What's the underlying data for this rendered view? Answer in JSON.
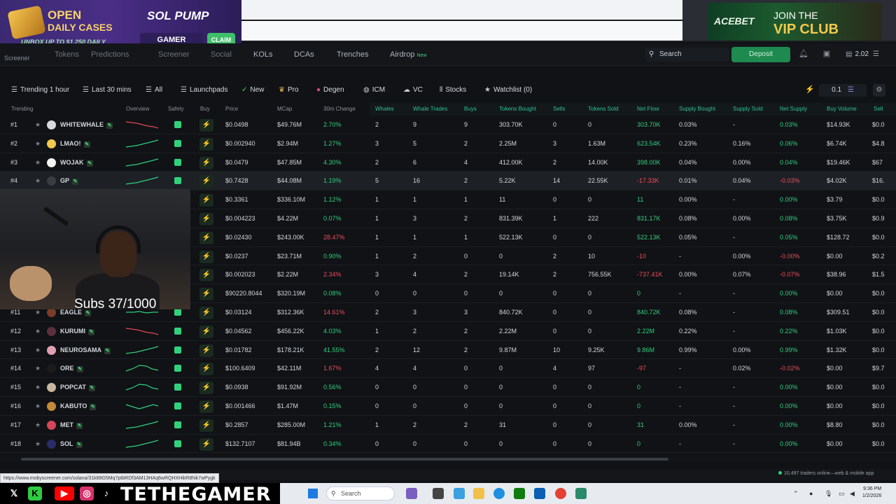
{
  "promo_left": {
    "open": "OPEN",
    "daily_cases": "DAILY CASES",
    "unbox": "UNBOX UP TO $1,250 DAILY",
    "logo": "SOL PUMP",
    "gamer": "GAMER",
    "claim": "CLAIM"
  },
  "promo_right": {
    "brand": "ACEBET",
    "join": "JOIN THE",
    "vip": "VIP CLUB"
  },
  "nav": {
    "logo": "Screener",
    "items": [
      "Tokens",
      "Predictions",
      "Screener",
      "Social",
      "KOLs",
      "DCAs",
      "Trenches",
      "Airdrop"
    ],
    "new_badge": "New",
    "search_label": "Search",
    "deposit_label": "Deposit",
    "balance": "2.02"
  },
  "filters": {
    "trending": "Trending 1 hour",
    "timeframe": "Last 30 mins",
    "all": "All",
    "launchpads": "Launchpads",
    "new": "New",
    "pro": "Pro",
    "degen": "Degen",
    "icm": "ICM",
    "vc": "VC",
    "stocks": "Stocks",
    "watchlist": "Watchlist (0)",
    "amount": "0.1"
  },
  "columns": [
    "Trending",
    "Overview",
    "Safety",
    "Buy",
    "Price",
    "MCap",
    "30m Change",
    "Whales",
    "Whale Trades",
    "Buys",
    "Tokens Bought",
    "Sells",
    "Tokens Sold",
    "Net Flow",
    "Supply Bought",
    "Supply Sold",
    "Net Supply",
    "Buy Volume",
    "Sell"
  ],
  "rows": [
    {
      "rank": "#1",
      "name": "WHITEWHALE",
      "price": "$0.0498",
      "mcap": "$49.76M",
      "change": "2.70%",
      "whales": "2",
      "whale_trades": "9",
      "buys": "9",
      "tokens_bought": "303.70K",
      "sells": "0",
      "tokens_sold": "0",
      "net_flow": "303.70K",
      "supply_bought": "0.03%",
      "supply_sold": "-",
      "net_supply": "0.03%",
      "buy_volume": "$14.93K",
      "sell": "$0.0",
      "avatar_color": "#d7d9dc",
      "change_sign": "pos",
      "flow_sign": "pos",
      "supply_sign": "pos",
      "spark": "down"
    },
    {
      "rank": "#2",
      "name": "LMAO!",
      "price": "$0.002940",
      "mcap": "$2.94M",
      "change": "1.27%",
      "whales": "3",
      "whale_trades": "5",
      "buys": "2",
      "tokens_bought": "2.25M",
      "sells": "3",
      "tokens_sold": "1.63M",
      "net_flow": "623.54K",
      "supply_bought": "0.23%",
      "supply_sold": "0.16%",
      "net_supply": "0.06%",
      "buy_volume": "$6.74K",
      "sell": "$4.8",
      "avatar_color": "#f2c94c",
      "change_sign": "pos",
      "flow_sign": "pos",
      "supply_sign": "pos",
      "spark": "up"
    },
    {
      "rank": "#3",
      "name": "WOJAK",
      "price": "$0.0479",
      "mcap": "$47.85M",
      "change": "4.30%",
      "whales": "2",
      "whale_trades": "6",
      "buys": "4",
      "tokens_bought": "412.00K",
      "sells": "2",
      "tokens_sold": "14.00K",
      "net_flow": "398.00K",
      "supply_bought": "0.04%",
      "supply_sold": "0.00%",
      "net_supply": "0.04%",
      "buy_volume": "$19.46K",
      "sell": "$67",
      "avatar_color": "#f4f4f4",
      "change_sign": "pos",
      "flow_sign": "pos",
      "supply_sign": "pos",
      "spark": "up"
    },
    {
      "rank": "#4",
      "name": "GP",
      "price": "$0.7428",
      "mcap": "$44.08M",
      "change": "1.19%",
      "whales": "5",
      "whale_trades": "16",
      "buys": "2",
      "tokens_bought": "5.22K",
      "sells": "14",
      "tokens_sold": "22.55K",
      "net_flow": "-17.33K",
      "supply_bought": "0.01%",
      "supply_sold": "0.04%",
      "net_supply": "-0.03%",
      "buy_volume": "$4.02K",
      "sell": "$16.",
      "avatar_color": "#3a3d42",
      "change_sign": "pos",
      "flow_sign": "neg",
      "supply_sign": "neg",
      "spark": "up"
    },
    {
      "rank": "",
      "name": "",
      "price": "$0.3361",
      "mcap": "$336.10M",
      "change": "1.12%",
      "whales": "1",
      "whale_trades": "1",
      "buys": "1",
      "tokens_bought": "11",
      "sells": "0",
      "tokens_sold": "0",
      "net_flow": "11",
      "supply_bought": "0.00%",
      "supply_sold": "-",
      "net_supply": "0.00%",
      "buy_volume": "$3.79",
      "sell": "$0.0",
      "avatar_color": "",
      "change_sign": "pos",
      "flow_sign": "pos",
      "supply_sign": "pos",
      "spark": ""
    },
    {
      "rank": "",
      "name": "",
      "price": "$0.004223",
      "mcap": "$4.22M",
      "change": "0.07%",
      "whales": "1",
      "whale_trades": "3",
      "buys": "2",
      "tokens_bought": "831.39K",
      "sells": "1",
      "tokens_sold": "222",
      "net_flow": "831.17K",
      "supply_bought": "0.08%",
      "supply_sold": "0.00%",
      "net_supply": "0.08%",
      "buy_volume": "$3.75K",
      "sell": "$0.9",
      "avatar_color": "",
      "change_sign": "pos",
      "flow_sign": "pos",
      "supply_sign": "pos",
      "spark": ""
    },
    {
      "rank": "",
      "name": "",
      "price": "$0.02430",
      "mcap": "$243.00K",
      "change": "28.47%",
      "whales": "1",
      "whale_trades": "1",
      "buys": "1",
      "tokens_bought": "522.13K",
      "sells": "0",
      "tokens_sold": "0",
      "net_flow": "522.13K",
      "supply_bought": "0.05%",
      "supply_sold": "-",
      "net_supply": "0.05%",
      "buy_volume": "$128.72",
      "sell": "$0.0",
      "avatar_color": "",
      "change_sign": "neg",
      "flow_sign": "pos",
      "supply_sign": "pos",
      "spark": ""
    },
    {
      "rank": "",
      "name": "",
      "price": "$0.0237",
      "mcap": "$23.71M",
      "change": "0.90%",
      "whales": "1",
      "whale_trades": "2",
      "buys": "0",
      "tokens_bought": "0",
      "sells": "2",
      "tokens_sold": "10",
      "net_flow": "-10",
      "supply_bought": "-",
      "supply_sold": "0.00%",
      "net_supply": "-0.00%",
      "buy_volume": "$0.00",
      "sell": "$0.2",
      "avatar_color": "",
      "change_sign": "pos",
      "flow_sign": "neg",
      "supply_sign": "neg",
      "spark": ""
    },
    {
      "rank": "",
      "name": "",
      "price": "$0.002023",
      "mcap": "$2.22M",
      "change": "2.34%",
      "whales": "3",
      "whale_trades": "4",
      "buys": "2",
      "tokens_bought": "19.14K",
      "sells": "2",
      "tokens_sold": "756.55K",
      "net_flow": "-737.41K",
      "supply_bought": "0.00%",
      "supply_sold": "0.07%",
      "net_supply": "-0.07%",
      "buy_volume": "$38.96",
      "sell": "$1.5",
      "avatar_color": "",
      "change_sign": "neg",
      "flow_sign": "neg",
      "supply_sign": "neg",
      "spark": ""
    },
    {
      "rank": "",
      "name": "",
      "price": "$90220.8044",
      "mcap": "$320.19M",
      "change": "0.08%",
      "whales": "0",
      "whale_trades": "0",
      "buys": "0",
      "tokens_bought": "0",
      "sells": "0",
      "tokens_sold": "0",
      "net_flow": "0",
      "supply_bought": "-",
      "supply_sold": "-",
      "net_supply": "0.00%",
      "buy_volume": "$0.00",
      "sell": "$0.0",
      "avatar_color": "",
      "change_sign": "pos",
      "flow_sign": "pos",
      "supply_sign": "pos",
      "spark": ""
    },
    {
      "rank": "#11",
      "name": "EAGLE",
      "price": "$0.03124",
      "mcap": "$312.36K",
      "change": "14.61%",
      "whales": "2",
      "whale_trades": "3",
      "buys": "3",
      "tokens_bought": "840.72K",
      "sells": "0",
      "tokens_sold": "0",
      "net_flow": "840.72K",
      "supply_bought": "0.08%",
      "supply_sold": "-",
      "net_supply": "0.08%",
      "buy_volume": "$309.51",
      "sell": "$0.0",
      "avatar_color": "#7b3b2a",
      "change_sign": "neg",
      "flow_sign": "pos",
      "supply_sign": "pos",
      "spark": "flat"
    },
    {
      "rank": "#12",
      "name": "KURUMI",
      "price": "$0.04562",
      "mcap": "$456.22K",
      "change": "4.03%",
      "whales": "1",
      "whale_trades": "2",
      "buys": "2",
      "tokens_bought": "2.22M",
      "sells": "0",
      "tokens_sold": "0",
      "net_flow": "2.22M",
      "supply_bought": "0.22%",
      "supply_sold": "-",
      "net_supply": "0.22%",
      "buy_volume": "$1.03K",
      "sell": "$0.0",
      "avatar_color": "#5b2f3c",
      "change_sign": "pos",
      "flow_sign": "pos",
      "supply_sign": "pos",
      "spark": "down"
    },
    {
      "rank": "#13",
      "name": "NEUROSAMA",
      "price": "$0.01782",
      "mcap": "$178.21K",
      "change": "41.55%",
      "whales": "2",
      "whale_trades": "12",
      "buys": "2",
      "tokens_bought": "9.87M",
      "sells": "10",
      "tokens_sold": "9.25K",
      "net_flow": "9.86M",
      "supply_bought": "0.99%",
      "supply_sold": "0.00%",
      "net_supply": "0.99%",
      "buy_volume": "$1.32K",
      "sell": "$0.0",
      "avatar_color": "#e0a0b0",
      "change_sign": "pos",
      "flow_sign": "pos",
      "supply_sign": "pos",
      "spark": "up"
    },
    {
      "rank": "#14",
      "name": "ORE",
      "price": "$100.6409",
      "mcap": "$42.11M",
      "change": "1.67%",
      "whales": "4",
      "whale_trades": "4",
      "buys": "0",
      "tokens_bought": "0",
      "sells": "4",
      "tokens_sold": "97",
      "net_flow": "-97",
      "supply_bought": "-",
      "supply_sold": "0.02%",
      "net_supply": "-0.02%",
      "buy_volume": "$0.00",
      "sell": "$9.7",
      "avatar_color": "#1b1b1b",
      "change_sign": "neg",
      "flow_sign": "neg",
      "supply_sign": "neg",
      "spark": "hump"
    },
    {
      "rank": "#15",
      "name": "POPCAT",
      "price": "$0.0938",
      "mcap": "$91.92M",
      "change": "0.56%",
      "whales": "0",
      "whale_trades": "0",
      "buys": "0",
      "tokens_bought": "0",
      "sells": "0",
      "tokens_sold": "0",
      "net_flow": "0",
      "supply_bought": "-",
      "supply_sold": "-",
      "net_supply": "0.00%",
      "buy_volume": "$0.00",
      "sell": "$0.0",
      "avatar_color": "#c9b89f",
      "change_sign": "pos",
      "flow_sign": "pos",
      "supply_sign": "pos",
      "spark": "hump"
    },
    {
      "rank": "#16",
      "name": "KABUTO",
      "price": "$0.001466",
      "mcap": "$1.47M",
      "change": "0.15%",
      "whales": "0",
      "whale_trades": "0",
      "buys": "0",
      "tokens_bought": "0",
      "sells": "0",
      "tokens_sold": "0",
      "net_flow": "0",
      "supply_bought": "-",
      "supply_sold": "-",
      "net_supply": "0.00%",
      "buy_volume": "$0.00",
      "sell": "$0.0",
      "avatar_color": "#c38a3a",
      "change_sign": "pos",
      "flow_sign": "pos",
      "supply_sign": "pos",
      "spark": "wave"
    },
    {
      "rank": "#17",
      "name": "MET",
      "price": "$0.2857",
      "mcap": "$285.00M",
      "change": "1.21%",
      "whales": "1",
      "whale_trades": "2",
      "buys": "2",
      "tokens_bought": "31",
      "sells": "0",
      "tokens_sold": "0",
      "net_flow": "31",
      "supply_bought": "0.00%",
      "supply_sold": "-",
      "net_supply": "0.00%",
      "buy_volume": "$8.80",
      "sell": "$0.0",
      "avatar_color": "#d6455a",
      "change_sign": "pos",
      "flow_sign": "pos",
      "supply_sign": "pos",
      "spark": "up"
    },
    {
      "rank": "#18",
      "name": "SOL",
      "price": "$132.7107",
      "mcap": "$81.94B",
      "change": "0.34%",
      "whales": "0",
      "whale_trades": "0",
      "buys": "0",
      "tokens_bought": "0",
      "sells": "0",
      "tokens_sold": "0",
      "net_flow": "0",
      "supply_bought": "-",
      "supply_sold": "-",
      "net_supply": "0.00%",
      "buy_volume": "$0.00",
      "sell": "$0.0",
      "avatar_color": "#2a2d6a",
      "change_sign": "pos",
      "flow_sign": "pos",
      "supply_sign": "pos",
      "spark": "up"
    }
  ],
  "webcam": {
    "subs": "Subs 37/1000"
  },
  "status": {
    "url": "https://www.mobyscreener.com/solana/31k88G5Mq7ptbRDf3AM13HAq6wRQHXHikR8hik7wPygk",
    "traders": "10,497 traders online—web & mobile app"
  },
  "social": {
    "handle": "TETHEGAMER"
  },
  "taskbar": {
    "search": "Search",
    "time": "9:36 PM",
    "date": "1/2/2026"
  },
  "colors": {
    "positive": "#2fcf7f",
    "negative": "#ef4b5a",
    "accent": "#1e8a4f"
  }
}
